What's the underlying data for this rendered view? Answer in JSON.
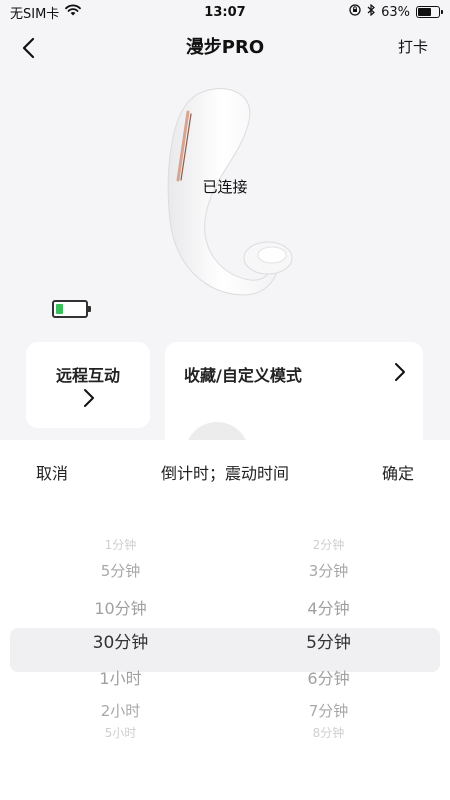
{
  "status_bar": {
    "carrier": "无SIM卡",
    "time": "13:07",
    "battery_pct": "63%",
    "battery_level": 0.63
  },
  "nav": {
    "title": "漫步PRO",
    "right_action": "打卡"
  },
  "device": {
    "status": "已连接",
    "battery_level": 0.25
  },
  "cards": {
    "remote_label": "远程互动",
    "favorite_label": "收藏/自定义模式"
  },
  "picker": {
    "cancel_label": "取消",
    "title": "倒计时；震动时间",
    "confirm_label": "确定",
    "left_column": {
      "items": [
        "1分钟",
        "5分钟",
        "10分钟",
        "30分钟",
        "1小时",
        "2小时",
        "5小时"
      ],
      "selected_index": 3
    },
    "right_column": {
      "items": [
        "2分钟",
        "3分钟",
        "4分钟",
        "5分钟",
        "6分钟",
        "7分钟",
        "8分钟"
      ],
      "selected_index": 3
    }
  },
  "colors": {
    "battery_green": "#3bbf5a",
    "highlight_bg": "#f0f0f2"
  }
}
